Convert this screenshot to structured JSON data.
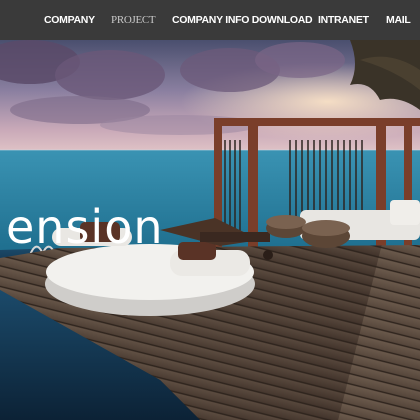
{
  "nav": {
    "items": [
      {
        "label": "COMPANY",
        "key": "company"
      },
      {
        "label": "PROJECT",
        "key": "project"
      },
      {
        "label": "COMPANY INFO DOWNLOAD",
        "key": "download"
      },
      {
        "label": "INTRANET",
        "key": "intranet"
      },
      {
        "label": "MAIL",
        "key": "mail"
      }
    ]
  },
  "hero": {
    "headline": "ension"
  },
  "colors": {
    "navbar_bg": "#3a3a3a",
    "nav_text": "#ffffff",
    "nav_text_active": "#c8c8c8",
    "sea": "#2a8fb0",
    "deck": "#5a4a3e"
  }
}
